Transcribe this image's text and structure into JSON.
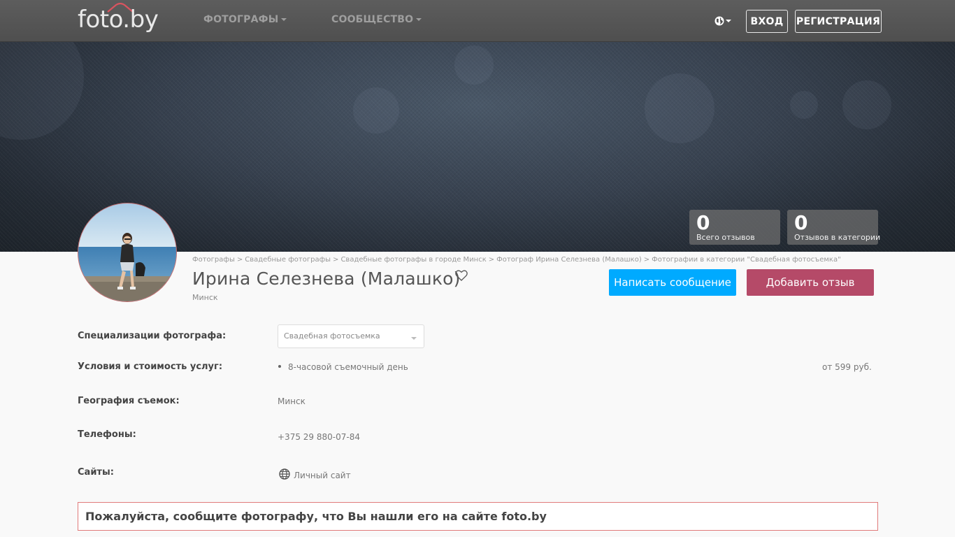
{
  "header": {
    "logo_text": "foto.by",
    "nav": [
      {
        "label": "ФОТОГРАФЫ"
      },
      {
        "label": "СООБЩЕСТВО"
      }
    ],
    "login_label": "ВХОД",
    "register_label": "РЕГИСТРАЦИЯ"
  },
  "stats": [
    {
      "value": "0",
      "label": "Всего отзывов"
    },
    {
      "value": "0",
      "label": "Отзывов в категории"
    }
  ],
  "breadcrumb": [
    "Фотографы",
    "Свадебные фотографы",
    "Свадебные фотографы в городе Минск",
    "Фотограф Ирина Селезнева (Малашко)",
    "Фотографии в категории \"Свадебная фотосъемка\""
  ],
  "profile": {
    "name": "Ирина Селезнева (Малашко)",
    "city": "Минск",
    "message_button": "Написать сообщение",
    "review_button": "Добавить отзыв"
  },
  "details": {
    "specializations_label": "Специализации фотографа:",
    "specialization_selected": "Свадебная фотосъемка",
    "services_label": "Условия и стоимость услуг:",
    "service_name": "8-часовой съемочный день",
    "service_price": "от 599 руб.",
    "geography_label": "География съемок:",
    "geography_value": "Минск",
    "phones_label": "Телефоны:",
    "phone_value": "+375 29 880-07-84",
    "sites_label": "Сайты:",
    "site_link": "Личный сайт"
  },
  "notice": "Пожалуйста, сообщите фотографу, что Вы нашли его на сайте foto.by",
  "colors": {
    "message_button": "#00aaff",
    "review_button": "#b54a68",
    "navbar": "#575757",
    "notice_border": "#e07a7a"
  }
}
